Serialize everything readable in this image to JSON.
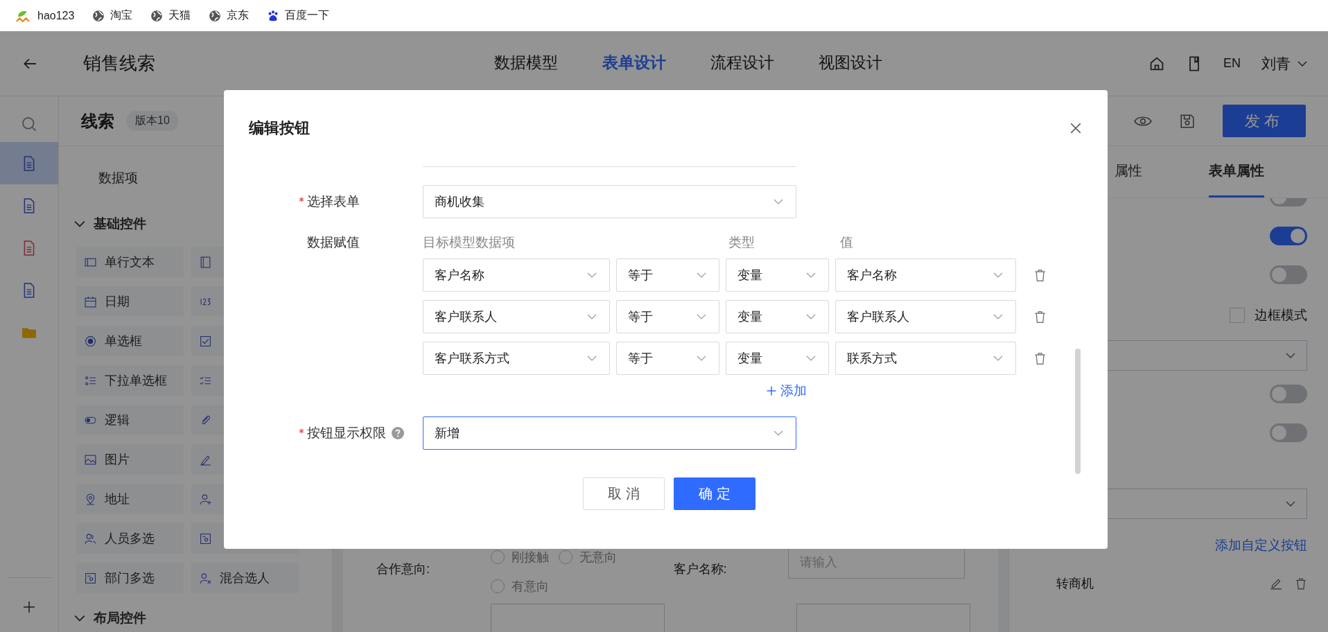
{
  "bookmarks": [
    {
      "label": "hao123",
      "kind": "hao"
    },
    {
      "label": "淘宝",
      "kind": "globe"
    },
    {
      "label": "天猫",
      "kind": "globe"
    },
    {
      "label": "京东",
      "kind": "globe"
    },
    {
      "label": "百度一下",
      "kind": "paw"
    }
  ],
  "header": {
    "title": "销售线索",
    "tabs": [
      {
        "label": "数据模型",
        "selected": false
      },
      {
        "label": "表单设计",
        "selected": true
      },
      {
        "label": "流程设计",
        "selected": false
      },
      {
        "label": "视图设计",
        "selected": false
      }
    ],
    "language": "EN",
    "user": "刘青"
  },
  "rail": {
    "items": [
      {
        "kind": "form",
        "selected": true
      },
      {
        "kind": "form",
        "selected": false
      },
      {
        "kind": "report",
        "selected": false
      },
      {
        "kind": "form",
        "selected": false
      },
      {
        "kind": "folder",
        "selected": false
      }
    ]
  },
  "left_panel": {
    "form_name": "线索",
    "version": "版本10",
    "tab": "数据项",
    "sections": [
      {
        "title": "基础控件",
        "expanded": true,
        "items": [
          {
            "kind": "text",
            "label": "单行文本"
          },
          {
            "kind": "textarea"
          },
          {
            "kind": "date",
            "label": "日期"
          },
          {
            "kind": "number"
          },
          {
            "kind": "radio",
            "label": "单选框"
          },
          {
            "kind": "checkbox"
          },
          {
            "kind": "select",
            "label": "下拉单选框"
          },
          {
            "kind": "multiselect"
          },
          {
            "kind": "toggle",
            "label": "逻辑"
          },
          {
            "kind": "attachment"
          },
          {
            "kind": "image",
            "label": "图片"
          },
          {
            "kind": "signature"
          },
          {
            "kind": "address",
            "label": "地址"
          },
          {
            "kind": "member"
          },
          {
            "kind": "members",
            "label": "人员多选"
          },
          {
            "kind": "department"
          },
          {
            "kind": "departments",
            "label": "部门多选"
          },
          {
            "kind": "mixed",
            "label": "混合选人"
          }
        ]
      },
      {
        "title": "布局控件",
        "expanded": true
      }
    ]
  },
  "canvas": {
    "fields": [
      {
        "kind": "radio",
        "label": "合作意向:",
        "options": [
          {
            "label": "刚接触",
            "selected": false
          },
          {
            "label": "无意向",
            "selected": false
          },
          {
            "label": "有意向",
            "selected": false
          }
        ]
      },
      {
        "kind": "input",
        "label": "客户名称:",
        "placeholder": "请输入"
      }
    ]
  },
  "right_panel": {
    "publish": "发布",
    "tabs": [
      {
        "label": "属性",
        "selected": false
      },
      {
        "label": "表单属性",
        "selected": true
      }
    ],
    "settings": [
      {
        "kind": "toggle",
        "on": false
      },
      {
        "kind": "toggle",
        "on": true
      },
      {
        "kind": "toggle",
        "on": false
      },
      {
        "kind": "checkbox",
        "label": "边框模式",
        "checked": false
      },
      {
        "kind": "select"
      },
      {
        "kind": "toggle",
        "on": false
      },
      {
        "kind": "toggle",
        "on": false
      },
      {
        "kind": "select"
      },
      {
        "kind": "link",
        "label": "添加自定义按钮"
      }
    ],
    "custom_buttons": [
      {
        "label": "转商机"
      }
    ]
  },
  "modal": {
    "title": "编辑按钮",
    "form_select": {
      "label": "选择表单",
      "required": true,
      "value": "商机收集"
    },
    "mapping": {
      "label": "数据赋值",
      "columns": [
        "目标模型数据项",
        "类型",
        "值"
      ],
      "rows": [
        {
          "target": "客户名称",
          "operator": "等于",
          "type": "变量",
          "value": "客户名称"
        },
        {
          "target": "客户联系人",
          "operator": "等于",
          "type": "变量",
          "value": "客户联系人"
        },
        {
          "target": "客户联系方式",
          "operator": "等于",
          "type": "变量",
          "value": "联系方式"
        }
      ],
      "add": "添加"
    },
    "permission": {
      "label": "按钮显示权限",
      "required": true,
      "help": true,
      "value": "新增",
      "focused": true
    },
    "cancel": "取 消",
    "ok": "确 定"
  }
}
